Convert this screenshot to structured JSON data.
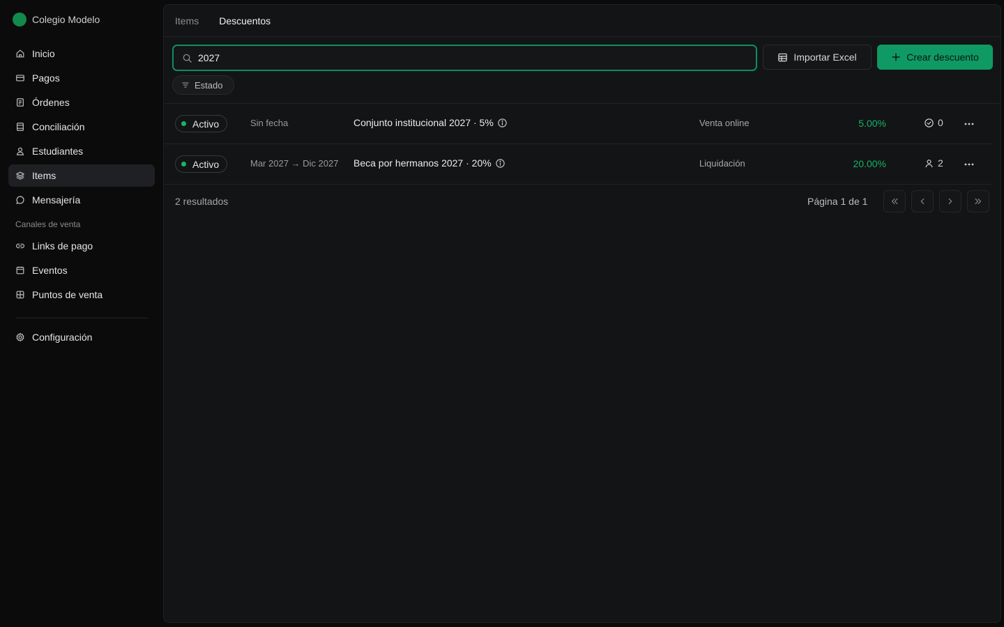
{
  "brand": {
    "name": "Colegio Modelo"
  },
  "sidebar": {
    "items": [
      {
        "label": "Inicio",
        "icon": "home-icon"
      },
      {
        "label": "Pagos",
        "icon": "card-icon"
      },
      {
        "label": "Órdenes",
        "icon": "document-icon"
      },
      {
        "label": "Conciliación",
        "icon": "ledger-icon"
      },
      {
        "label": "Estudiantes",
        "icon": "user-icon"
      },
      {
        "label": "Items",
        "icon": "layers-icon",
        "active": true
      },
      {
        "label": "Mensajería",
        "icon": "chat-icon"
      }
    ],
    "section_label": "Canales de venta",
    "channels": [
      {
        "label": "Links de pago",
        "icon": "link-icon"
      },
      {
        "label": "Eventos",
        "icon": "calendar-icon"
      },
      {
        "label": "Puntos de venta",
        "icon": "store-icon"
      }
    ],
    "settings": {
      "label": "Configuración",
      "icon": "gear-icon"
    }
  },
  "tabs": [
    {
      "label": "Items",
      "active": false
    },
    {
      "label": "Descuentos",
      "active": true
    }
  ],
  "toolbar": {
    "search_value": "2027",
    "import_label": "Importar Excel",
    "create_label": "Crear descuento"
  },
  "filters": {
    "estado_label": "Estado"
  },
  "rows": [
    {
      "status": "Activo",
      "dates": "Sin fecha",
      "name": "Conjunto institucional 2027 · 5%",
      "channel": "Venta online",
      "percent": "5.00%",
      "count": "0",
      "count_icon": "check-circle-icon"
    },
    {
      "status": "Activo",
      "dates": "Mar 2027 → Dic 2027",
      "name": "Beca por hermanos 2027 · 20%",
      "channel": "Liquidación",
      "percent": "20.00%",
      "count": "2",
      "count_icon": "person-icon"
    }
  ],
  "footer": {
    "results": "2 resultados",
    "page_info": "Página 1 de 1"
  },
  "colors": {
    "accent": "#0f9a63",
    "accent_text": "#17b26a",
    "background": "#0b0b0c",
    "panel": "#131415"
  }
}
